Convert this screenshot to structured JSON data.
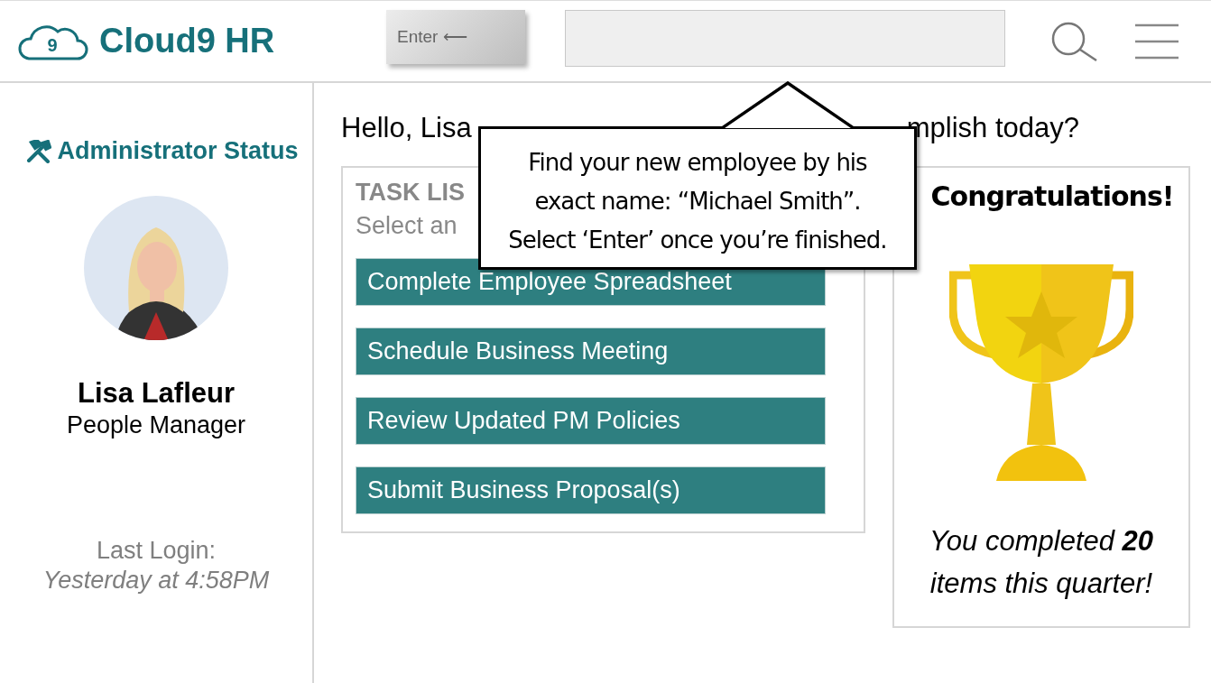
{
  "header": {
    "logo_digit": "9",
    "brand": "Cloud9 HR",
    "enter_button": "Enter ⟵"
  },
  "sidebar": {
    "status": "Administrator Status",
    "name": "Lisa Lafleur",
    "role": "People Manager",
    "last_login_label": "Last Login:",
    "last_login_value": "Yesterday at 4:58PM"
  },
  "greeting": {
    "before": "Hello, Lisa",
    "after": "mplish today?"
  },
  "task_list": {
    "title": "TASK LIS",
    "subtitle": "Select an",
    "tasks": [
      {
        "label": "Complete Employee Spreadsheet"
      },
      {
        "label": "Schedule Business Meeting"
      },
      {
        "label": "Review Updated PM Policies"
      },
      {
        "label": "Submit Business Proposal(s)"
      }
    ]
  },
  "achievement": {
    "title": "Congratulations!",
    "message": "You completed **20** items this quarter!"
  },
  "callout": {
    "lines": [
      "Find your new employee by his",
      "exact name: “Michael Smith”.",
      "Select ‘Enter’ once you’re finished."
    ]
  }
}
